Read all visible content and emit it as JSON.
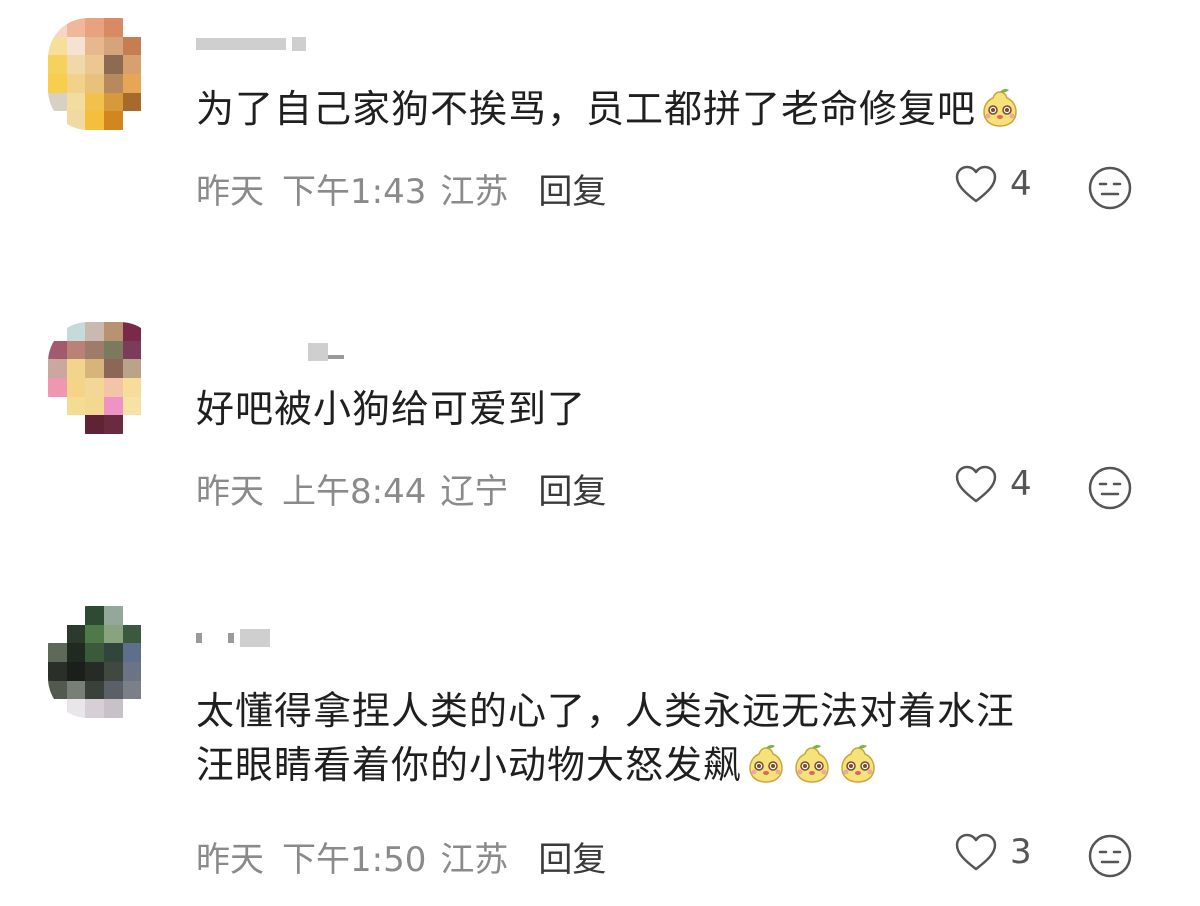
{
  "colors": {
    "text": "#1f1f1f",
    "meta": "#8a8a8a",
    "reply": "#3a3a3a",
    "icon": "#555555"
  },
  "comments": [
    {
      "text_lines": [
        "为了自己家狗不挨骂，员工都拼了老命修复吧"
      ],
      "emoji_count": 1,
      "date": "昨天",
      "time": "下午1:43",
      "location": "江苏",
      "reply_label": "回复",
      "likes": "4",
      "icons": {
        "like": "heart-outline-icon",
        "react": "neutral-face-icon",
        "emoji": "pear-emoji-icon"
      }
    },
    {
      "text_lines": [
        "好吧被小狗给可爱到了"
      ],
      "emoji_count": 0,
      "date": "昨天",
      "time": "上午8:44",
      "location": "辽宁",
      "reply_label": "回复",
      "likes": "4",
      "icons": {
        "like": "heart-outline-icon",
        "react": "neutral-face-icon"
      }
    },
    {
      "text_lines": [
        "太懂得拿捏人类的心了，人类永远无法对着水汪",
        "汪眼睛看着你的小动物大怒发飙"
      ],
      "emoji_count": 3,
      "date": "昨天",
      "time": "下午1:50",
      "location": "江苏",
      "reply_label": "回复",
      "likes": "3",
      "icons": {
        "like": "heart-outline-icon",
        "react": "neutral-face-icon",
        "emoji": "pear-emoji-icon"
      }
    }
  ]
}
